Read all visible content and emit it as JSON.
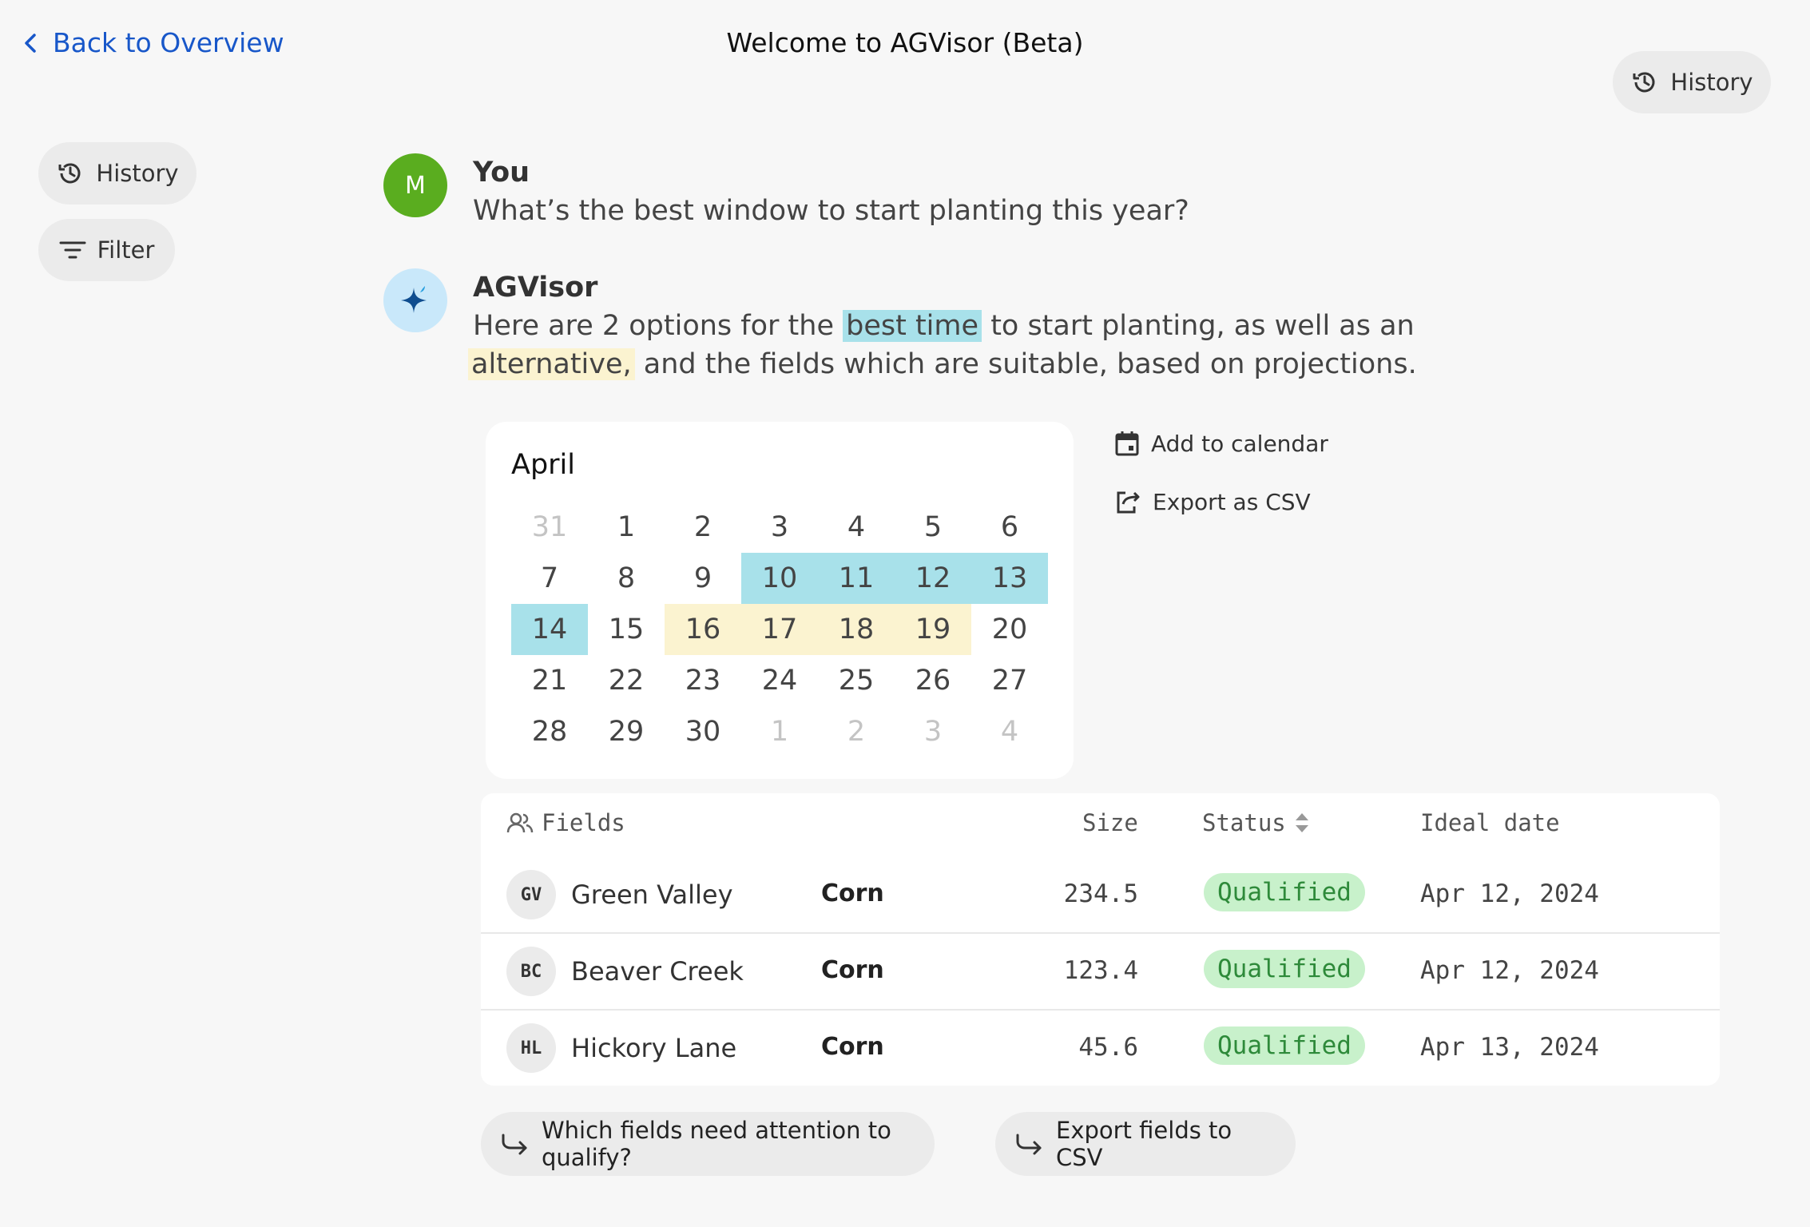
{
  "header": {
    "back_label": "Back to Overview",
    "title": "Welcome to AGVisor (Beta)",
    "history_label": "History"
  },
  "sidebar": {
    "history_label": "History",
    "filter_label": "Filter"
  },
  "chat": {
    "user": {
      "initial": "M",
      "name": "You",
      "text": "What’s the best window to start planting this year?"
    },
    "bot": {
      "name": "AGVisor",
      "text_1": "Here are 2 options for the",
      "highlight_best": "best time",
      "text_2": "to start planting, as well as an",
      "highlight_alt": "alternative,",
      "text_3": "and the fields which are suitable, based on projections."
    }
  },
  "calendar": {
    "month": "April",
    "weeks": [
      [
        {
          "d": "31",
          "s": "muted"
        },
        {
          "d": "1"
        },
        {
          "d": "2"
        },
        {
          "d": "3"
        },
        {
          "d": "4"
        },
        {
          "d": "5"
        },
        {
          "d": "6"
        }
      ],
      [
        {
          "d": "7"
        },
        {
          "d": "8"
        },
        {
          "d": "9"
        },
        {
          "d": "10",
          "s": "best"
        },
        {
          "d": "11",
          "s": "best"
        },
        {
          "d": "12",
          "s": "best"
        },
        {
          "d": "13",
          "s": "best"
        }
      ],
      [
        {
          "d": "14",
          "s": "best"
        },
        {
          "d": "15"
        },
        {
          "d": "16",
          "s": "alt"
        },
        {
          "d": "17",
          "s": "alt"
        },
        {
          "d": "18",
          "s": "alt"
        },
        {
          "d": "19",
          "s": "alt"
        },
        {
          "d": "20"
        }
      ],
      [
        {
          "d": "21"
        },
        {
          "d": "22"
        },
        {
          "d": "23"
        },
        {
          "d": "24"
        },
        {
          "d": "25"
        },
        {
          "d": "26"
        },
        {
          "d": "27"
        }
      ],
      [
        {
          "d": "28"
        },
        {
          "d": "29"
        },
        {
          "d": "30"
        },
        {
          "d": "1",
          "s": "muted"
        },
        {
          "d": "2",
          "s": "muted"
        },
        {
          "d": "3",
          "s": "muted"
        },
        {
          "d": "4",
          "s": "muted"
        }
      ]
    ],
    "colors": {
      "best": "#a8e1ea",
      "alt": "#fbf3d0"
    }
  },
  "actions": {
    "add_calendar": "Add to calendar",
    "export_csv": "Export as CSV"
  },
  "table": {
    "headers": {
      "fields": "Fields",
      "size": "Size",
      "status": "Status",
      "ideal_date": "Ideal date"
    },
    "rows": [
      {
        "initials": "GV",
        "name": "Green Valley",
        "crop": "Corn",
        "size": "234.5",
        "status": "Qualified",
        "date": "Apr 12, 2024"
      },
      {
        "initials": "BC",
        "name": "Beaver Creek",
        "crop": "Corn",
        "size": "123.4",
        "status": "Qualified",
        "date": "Apr 12, 2024"
      },
      {
        "initials": "HL",
        "name": "Hickory Lane",
        "crop": "Corn",
        "size": "45.6",
        "status": "Qualified",
        "date": "Apr 13, 2024"
      }
    ]
  },
  "suggestions": {
    "s1": "Which fields need attention to qualify?",
    "s2": "Export fields to CSV"
  },
  "icons": {
    "back": "chevron-left-icon",
    "history": "history-icon",
    "filter": "filter-icon",
    "sparkle": "sparkle-icon",
    "calendar": "calendar-icon",
    "export": "export-icon",
    "people": "people-icon",
    "sort": "sort-icon",
    "reply": "reply-arrow-icon"
  }
}
